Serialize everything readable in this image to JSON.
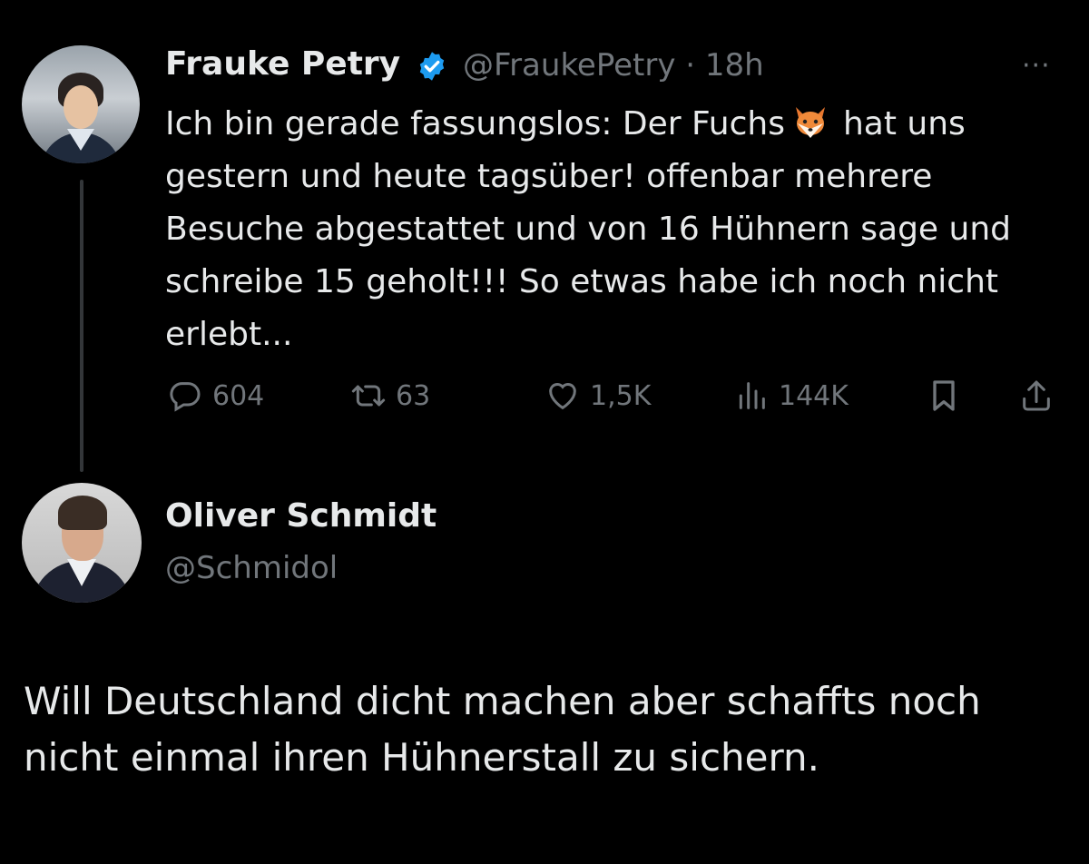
{
  "tweet1": {
    "name": "Frauke Petry",
    "handle_time": "@FraukePetry · 18h",
    "more": "···",
    "text_before_emoji": "Ich bin gerade fassungslos: Der Fuchs",
    "emoji": "fox-emoji",
    "text_after_emoji": "hat uns gestern und heute tagsüber! offenbar mehrere Besuche abgestattet und von 16 Hühnern sage und schreibe 15 geholt!!! So etwas habe ich noch nicht erlebt...",
    "actions": {
      "replies": "604",
      "retweets": "63",
      "likes": "1,5K",
      "views": "144K"
    }
  },
  "tweet2": {
    "name": "Oliver Schmidt",
    "handle": "@Schmidol",
    "text": "Will Deutschland dicht machen aber schaffts noch nicht einmal ihren Hühnerstall zu sichern."
  },
  "colors": {
    "background": "#000000",
    "text": "#e7e9ea",
    "secondary": "#71767b",
    "verified": "#1d9bf0"
  }
}
